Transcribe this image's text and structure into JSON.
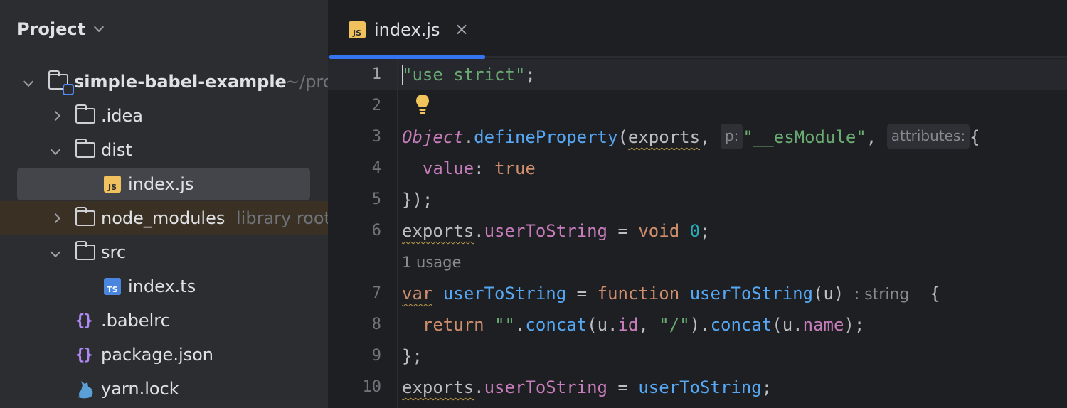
{
  "project_panel": {
    "title": "Project",
    "tree": [
      {
        "label": "simple-babel-example",
        "hint": "~/pro",
        "type": "project-folder",
        "expanded": true
      },
      {
        "label": ".idea",
        "type": "folder",
        "expanded": false
      },
      {
        "label": "dist",
        "type": "folder",
        "expanded": true
      },
      {
        "label": "index.js",
        "type": "js-file",
        "selected": true
      },
      {
        "label": "node_modules",
        "hint": "library root",
        "type": "folder",
        "expanded": false
      },
      {
        "label": "src",
        "type": "folder",
        "expanded": true
      },
      {
        "label": "index.ts",
        "type": "ts-file"
      },
      {
        "label": ".babelrc",
        "type": "config-file"
      },
      {
        "label": "package.json",
        "type": "config-file"
      },
      {
        "label": "yarn.lock",
        "type": "yarn-file"
      }
    ],
    "badges": {
      "js": "JS",
      "ts": "TS",
      "braces": "{}"
    }
  },
  "editor": {
    "tab": {
      "label": "index.js",
      "close": "×",
      "badge": "JS"
    },
    "line_numbers": [
      "1",
      "2",
      "3",
      "4",
      "5",
      "6",
      "7",
      "8",
      "9",
      "10"
    ],
    "usage_hint": "1 usage",
    "code": {
      "l1": {
        "str": "\"use strict\"",
        "semi": ";"
      },
      "l3": {
        "cls": "Object",
        "dot": ".",
        "fn": "defineProperty",
        "open": "(",
        "arg": "exports",
        "comma": ",",
        "hint_p": "p:",
        "str": "\"__esModule\"",
        "comma2": ",",
        "hint_attr": "attributes:",
        "brace": "{"
      },
      "l4": {
        "prop": "value",
        "colon": ":",
        "kw": "true"
      },
      "l5": {
        "text": "});"
      },
      "l6": {
        "obj": "exports",
        "dot": ".",
        "prop": "userToString",
        "eq": " = ",
        "kw": "void",
        "num": "0",
        "semi": ";"
      },
      "l7": {
        "kw_var": "var",
        "name": "userToString",
        "eq": " = ",
        "kw_fn": "function",
        "fn": "userToString",
        "param": "(u)",
        "type_hint": ": string",
        "brace": "{"
      },
      "l8": {
        "kw": "return",
        "str1": "\"\"",
        "dot1": ".",
        "fn1": "concat",
        "open1": "(u.",
        "prop1": "id",
        "comma": ", ",
        "str2": "\"/\"",
        "close1": ")",
        "dot2": ".",
        "fn2": "concat",
        "open2": "(u.",
        "prop2": "name",
        "close2": ");"
      },
      "l9": {
        "text": "};"
      },
      "l10": {
        "obj": "exports",
        "dot": ".",
        "prop": "userToString",
        "eq": " = ",
        "fn": "userToString",
        "semi": ";"
      }
    }
  },
  "colors": {
    "keyword": "#cf8e6d",
    "string": "#6aab73",
    "number": "#2aacb8",
    "function": "#56a8f5",
    "property": "#c77dbb",
    "accent": "#3574f0"
  }
}
